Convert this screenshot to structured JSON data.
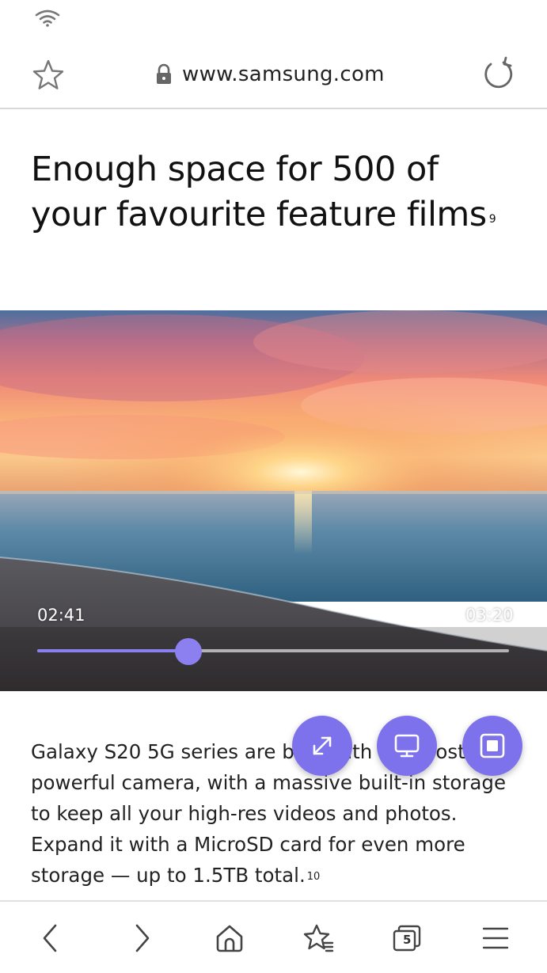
{
  "browser": {
    "url": "www.samsung.com",
    "tab_count": "5",
    "icons": [
      "wifi-icon",
      "star-icon",
      "lock-icon",
      "reload-icon",
      "back-icon",
      "forward-icon",
      "home-icon",
      "bookmarks-icon",
      "tabs-icon",
      "menu-icon"
    ]
  },
  "page": {
    "headline": "Enough space for 500 of your favourite feature films",
    "headline_note": "9",
    "body": "Galaxy S20 5G series are built with our most powerful camera, with a massive built-in storage to keep all your high-res videos and photos. Expand it with a MicroSD card for even more storage — up to 1.5TB total.",
    "body_note": "10"
  },
  "video": {
    "current_time": "02:41",
    "total_time": "03:20",
    "progress": 0.32,
    "accent_color": "#8c7ff0"
  },
  "floating_controls": {
    "color": "#7e71ec",
    "icons": [
      "expand-icon",
      "cast-icon",
      "picture-in-picture-icon"
    ]
  }
}
